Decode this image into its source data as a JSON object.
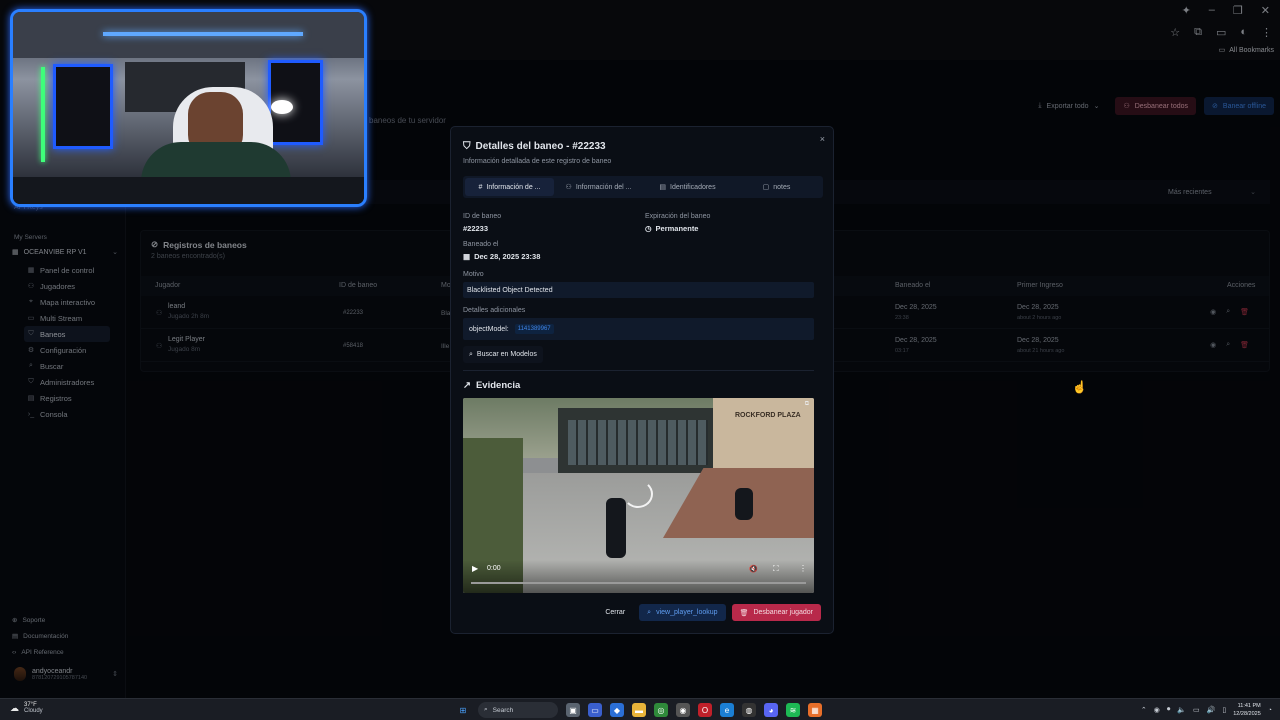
{
  "browser": {
    "bookmarks_label": "All Bookmarks",
    "win_min": "–",
    "win_max": "❐",
    "win_close": "✕"
  },
  "sidebar": {
    "api_keys_label": "API Keys",
    "section_label": "My Servers",
    "server_name": "OCEANVIBE RP V1",
    "items": [
      {
        "label": "Panel de control",
        "icon": "grid-icon"
      },
      {
        "label": "Jugadores",
        "icon": "users-icon"
      },
      {
        "label": "Mapa interactivo",
        "icon": "map-icon"
      },
      {
        "label": "Multi Stream",
        "icon": "monitor-icon"
      },
      {
        "label": "Baneos",
        "icon": "shield-icon"
      },
      {
        "label": "Configuración",
        "icon": "gear-icon"
      },
      {
        "label": "Buscar",
        "icon": "search-icon"
      },
      {
        "label": "Administradores",
        "icon": "shield-user-icon"
      },
      {
        "label": "Registros",
        "icon": "file-icon"
      },
      {
        "label": "Consola",
        "icon": "terminal-icon"
      }
    ],
    "active_index": 4,
    "footer": [
      {
        "label": "Soporte",
        "icon": "support-icon"
      },
      {
        "label": "Documentación",
        "icon": "book-icon"
      },
      {
        "label": "API Reference",
        "icon": "code-icon"
      }
    ],
    "user": {
      "name": "andyoceandr",
      "id": "878120729105787140"
    }
  },
  "page": {
    "subtitle": "baneos de tu servidor",
    "actions": {
      "export_label": "Exportar todo",
      "unban_all_label": "Desbanear todos",
      "ban_offline_label": "Banear offline"
    },
    "sort_label": "Más recientes"
  },
  "bans": {
    "title": "Registros de baneos",
    "count_text": "2 baneos encontrado(s)",
    "columns": [
      "Jugador",
      "ID de baneo",
      "Mo",
      "Baneado el",
      "Primer Ingreso",
      "Acciones"
    ],
    "rows": [
      {
        "name": "leand",
        "played": "Jugado 2h 8m",
        "ban_id": "#22233",
        "motive": "Bla",
        "banned_date": "Dec 28, 2025",
        "banned_time": "23:38",
        "first_date": "Dec 28, 2025",
        "first_ago": "about 2 hours ago"
      },
      {
        "name": "Legit Player",
        "played": "Jugado 8m",
        "ban_id": "#58418",
        "motive": "Ille",
        "banned_date": "Dec 28, 2025",
        "banned_time": "03:17",
        "first_date": "Dec 28, 2025",
        "first_ago": "about 21 hours ago"
      }
    ]
  },
  "modal": {
    "title": "Detalles del baneo - #22233",
    "subtitle": "Información detallada de este registro de baneo",
    "close_glyph": "×",
    "tabs": [
      {
        "label": "Información de ...",
        "icon": "hash-icon",
        "glyph": "#"
      },
      {
        "label": "Información del ...",
        "icon": "user-icon",
        "glyph": "⚇"
      },
      {
        "label": "Identificadores",
        "icon": "id-card-icon",
        "glyph": "▤"
      },
      {
        "label": "notes",
        "icon": "note-icon",
        "glyph": "▢"
      }
    ],
    "ban_id_label": "ID de baneo",
    "ban_id_value": "#22233",
    "expiry_label": "Expiración del baneo",
    "expiry_value": "Permanente",
    "banned_on_label": "Baneado el",
    "banned_on_value": "Dec 28, 2025 23:38",
    "motive_label": "Motivo",
    "motive_value": "Blacklisted Object Detected",
    "extra_label": "Detalles adicionales",
    "extra_key": "objectModel:",
    "extra_value": "1141389967",
    "search_models_label": "Buscar en Modelos",
    "evidence_title": "Evidencia",
    "video": {
      "time": "0:00",
      "sign_text": "ROCKFORD PLAZA"
    },
    "buttons": {
      "close_label": "Cerrar",
      "lookup_label": "view_player_lookup",
      "unban_label": "Desbanear jugador"
    }
  },
  "taskbar": {
    "temp": "37°F",
    "condition": "Cloudy",
    "search_label": "Search",
    "time": "11:41 PM",
    "date": "12/28/2025"
  }
}
